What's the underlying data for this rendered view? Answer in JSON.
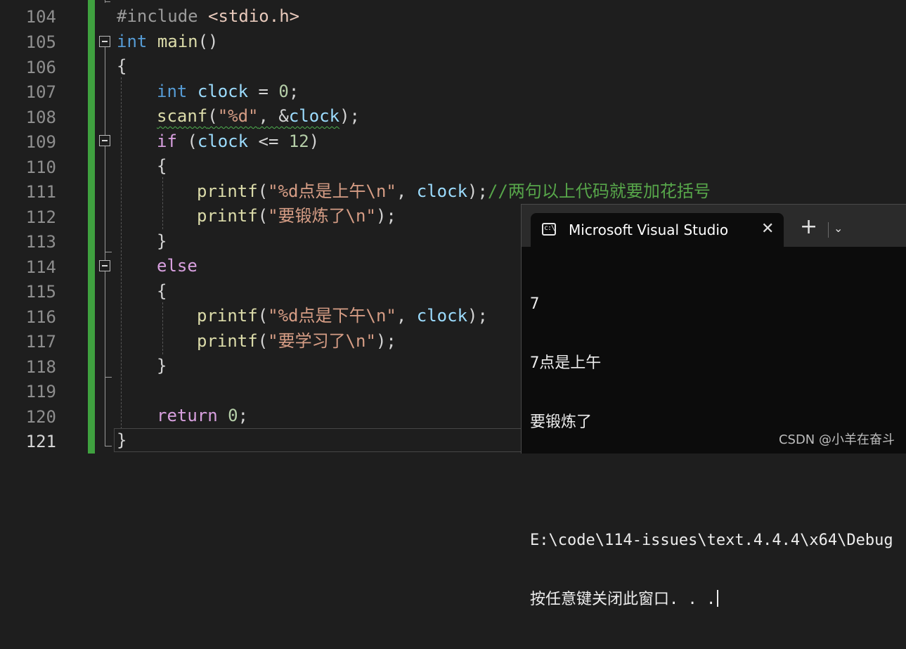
{
  "gutter": {
    "line_numbers": [
      "104",
      "105",
      "106",
      "107",
      "108",
      "109",
      "110",
      "111",
      "112",
      "113",
      "114",
      "115",
      "116",
      "117",
      "118",
      "119",
      "120",
      "121"
    ],
    "active_line": "121"
  },
  "code": {
    "l104": {
      "include": "#include",
      "header": "<stdio.h>"
    },
    "l105": {
      "type": "int",
      "name": "main",
      "parens": "()"
    },
    "l106": {
      "text": "{"
    },
    "l107": {
      "type": "int",
      "var": "clock",
      "op": " = ",
      "num": "0",
      "end": ";"
    },
    "l108": {
      "fn": "scanf",
      "open": "(",
      "fmt": "\"%d\"",
      "sep": ", &",
      "var": "clock",
      "end": ");"
    },
    "l109": {
      "kw": "if",
      "open": " (",
      "var": "clock",
      "op": " <= ",
      "num": "12",
      "close": ")"
    },
    "l110": {
      "text": "{"
    },
    "l111": {
      "fn": "printf",
      "open": "(",
      "str": "\"%d点是上午\\n\"",
      "sep": ", ",
      "var": "clock",
      "end": ");",
      "comment": "//两句以上代码就要加花括号"
    },
    "l112": {
      "fn": "printf",
      "open": "(",
      "str": "\"要锻炼了\\n\"",
      "end": ");"
    },
    "l113": {
      "text": "}"
    },
    "l114": {
      "kw": "else"
    },
    "l115": {
      "text": "{"
    },
    "l116": {
      "fn": "printf",
      "open": "(",
      "str": "\"%d点是下午\\n\"",
      "sep": ", ",
      "var": "clock",
      "end": ");"
    },
    "l117": {
      "fn": "printf",
      "open": "(",
      "str": "\"要学习了\\n\"",
      "end": ");"
    },
    "l118": {
      "text": "}"
    },
    "l120": {
      "kw": "return",
      "num": "0",
      "end": ";"
    },
    "l121": {
      "text": "}"
    }
  },
  "console": {
    "tab_title": "Microsoft Visual Studio",
    "tab_icon": "terminal-icon",
    "close_glyph": "✕",
    "new_tab_glyph": "+",
    "dropdown_glyph": "⌄",
    "output": [
      "7",
      "7点是上午",
      "要锻炼了",
      "",
      "E:\\code\\114-issues\\text.4.4.4\\x64\\Debug",
      "按任意键关闭此窗口. . ."
    ]
  },
  "watermark": "CSDN @小羊在奋斗",
  "colors": {
    "background": "#1e1e1e",
    "keyword": "#569cd6",
    "control": "#d8a0df",
    "function": "#dcdcaa",
    "variable": "#9cdcfe",
    "string": "#d69d85",
    "number": "#b5cea8",
    "comment": "#57a64a",
    "change_bar": "#3fa13f",
    "console_bg": "#0c0c0c"
  }
}
